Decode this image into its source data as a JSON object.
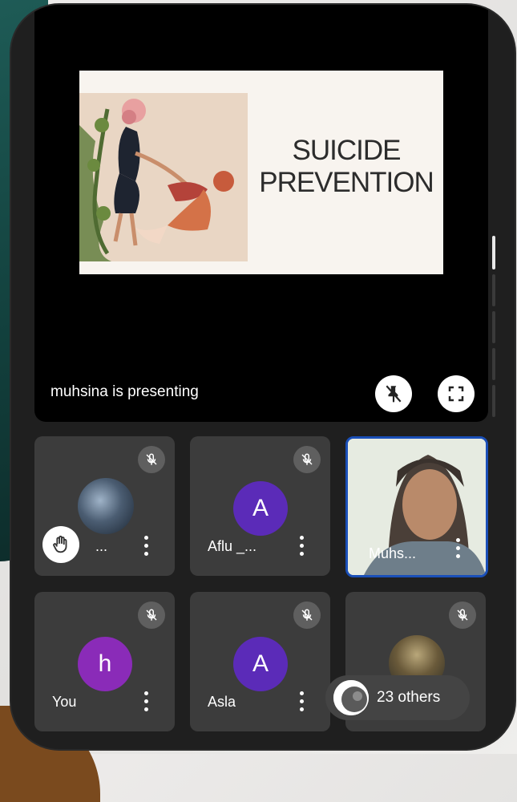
{
  "presentation": {
    "slide_title_line1": "SUICIDE",
    "slide_title_line2": "PREVENTION",
    "presenter_label": "muhsina is presenting"
  },
  "controls": {
    "unpin_icon": "unpin-icon",
    "fullscreen_icon": "fullscreen-icon"
  },
  "participants": [
    {
      "name": "...",
      "avatar": "photo"
    },
    {
      "name": "Aflu _...",
      "initial": "A",
      "avatar_color": "#5b2bb8"
    },
    {
      "name": "Muhs...",
      "avatar": "video"
    },
    {
      "name": "You",
      "initial": "h",
      "avatar_color": "#8a2bb8"
    },
    {
      "name": "Asla",
      "initial": "A",
      "avatar_color": "#5b2bb8"
    }
  ],
  "others": {
    "label": "23 others"
  },
  "colors": {
    "active_speaker_border": "#1a4fb8",
    "tile_bg": "#3c3c3c",
    "presentation_bg": "#000000"
  }
}
